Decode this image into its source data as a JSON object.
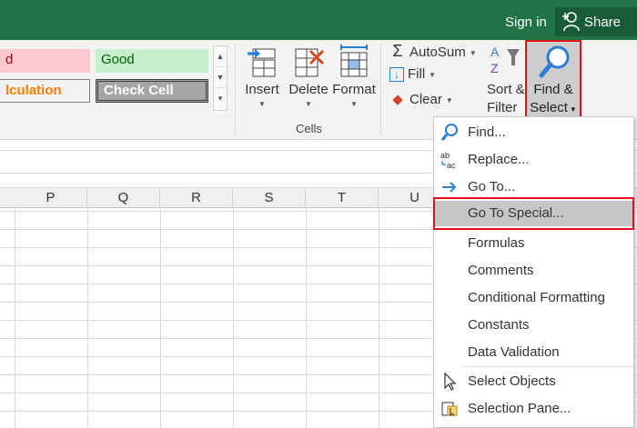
{
  "titlebar": {
    "signin": "Sign in",
    "share": "Share"
  },
  "styles": {
    "bad": "d",
    "good": "Good",
    "calculation": "lculation",
    "check_cell": "Check Cell"
  },
  "cells_group": {
    "insert": "Insert",
    "delete": "Delete",
    "format": "Format",
    "group_label": "Cells"
  },
  "editing": {
    "autosum": "AutoSum",
    "fill": "Fill",
    "clear": "Clear",
    "sort_filter_1": "Sort &",
    "sort_filter_2": "Filter",
    "find_select_1": "Find &",
    "find_select_2": "Select"
  },
  "columns": [
    "P",
    "Q",
    "R",
    "S",
    "T",
    "U"
  ],
  "menu": {
    "find": "Find...",
    "replace": "Replace...",
    "goto": "Go To...",
    "goto_special": "Go To Special...",
    "formulas": "Formulas",
    "comments": "Comments",
    "conditional_formatting": "Conditional Formatting",
    "constants": "Constants",
    "data_validation": "Data Validation",
    "select_objects": "Select Objects",
    "selection_pane": "Selection Pane..."
  },
  "colors": {
    "excel_green": "#217346",
    "highlight": "#e0101a",
    "menu_hover": "#c6c6c6"
  }
}
